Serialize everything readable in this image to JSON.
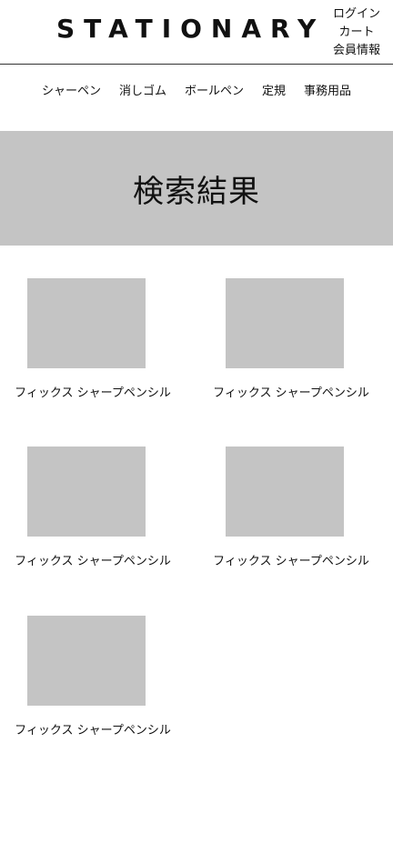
{
  "header": {
    "logo": "STATIONARY",
    "links": [
      "ログイン",
      "カート",
      "会員情報"
    ]
  },
  "nav": {
    "items": [
      "シャーペン",
      "消しゴム",
      "ボールペン",
      "定規",
      "事務用品"
    ]
  },
  "banner": {
    "title": "検索結果"
  },
  "products": [
    {
      "name": "フィックス シャープペンシル"
    },
    {
      "name": "フィックス シャープペンシル"
    },
    {
      "name": "フィックス シャープペンシル"
    },
    {
      "name": "フィックス シャープペンシル"
    },
    {
      "name": "フィックス シャープペンシル"
    }
  ],
  "colors": {
    "placeholder_gray": "#c4c4c4",
    "text": "#111111",
    "background": "#ffffff"
  }
}
